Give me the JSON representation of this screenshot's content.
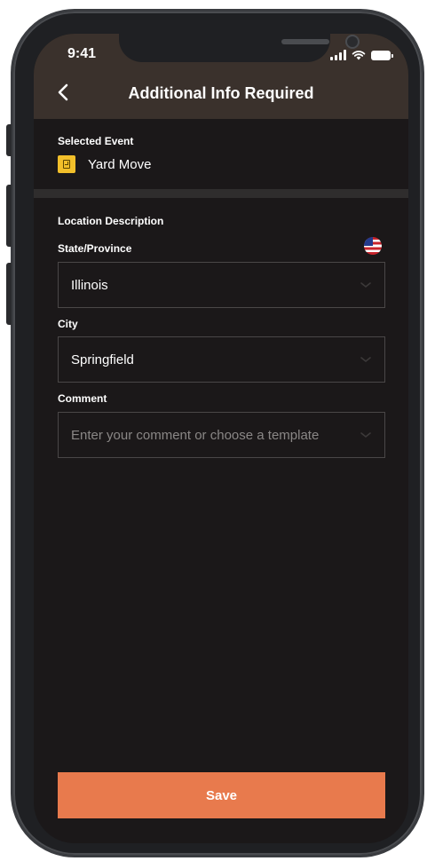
{
  "status_bar": {
    "time": "9:41",
    "icons": [
      "signal-icon",
      "wifi-icon",
      "battery-icon"
    ]
  },
  "header": {
    "title": "Additional Info Required",
    "back_icon": "chevron-left-icon"
  },
  "selected_event": {
    "label": "Selected Event",
    "name": "Yard Move",
    "icon": "yard-move-icon",
    "icon_color": "#f2bf2a"
  },
  "location": {
    "section_label": "Location Description",
    "state_label": "State/Province",
    "state_value": "Illinois",
    "country_icon": "us-flag-icon",
    "city_label": "City",
    "city_value": "Springfield",
    "comment_label": "Comment",
    "comment_placeholder": "Enter your comment or choose a template"
  },
  "actions": {
    "save_label": "Save",
    "save_color": "#e87a4d"
  },
  "theme": {
    "header_bg": "#3a312c",
    "screen_bg": "#1b1819",
    "field_border": "#4a4747"
  }
}
